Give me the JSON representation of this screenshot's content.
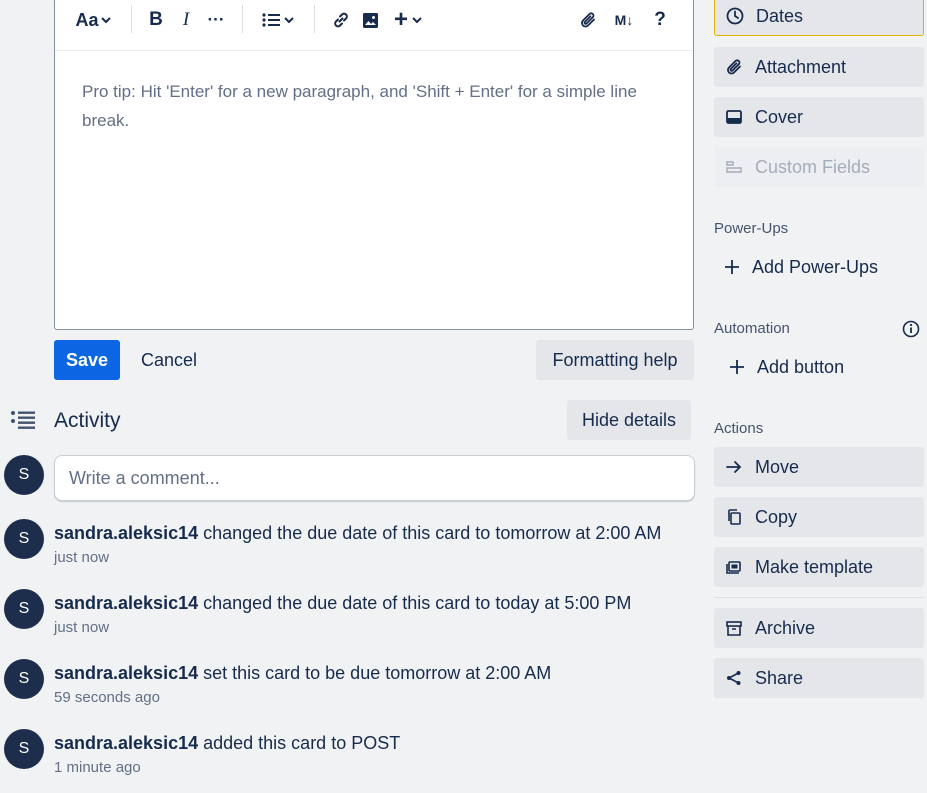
{
  "editor": {
    "toolbar": {
      "text_style": "Aa",
      "bold": "B",
      "italic": "I",
      "more": "···",
      "list": "list",
      "link": "link",
      "image": "image",
      "insert": "+",
      "attach": "attach",
      "markdown": "M↓",
      "help": "?"
    },
    "placeholder": "Pro tip: Hit 'Enter' for a new paragraph, and 'Shift + Enter' for a simple line break."
  },
  "actions": {
    "save": "Save",
    "cancel": "Cancel",
    "formatting_help": "Formatting help"
  },
  "activity": {
    "title": "Activity",
    "hide_details": "Hide details",
    "comment_placeholder": "Write a comment...",
    "avatar_initial": "S",
    "entries": [
      {
        "user": "sandra.aleksic14",
        "text": " changed the due date of this card to tomorrow at 2:00 AM",
        "time": "just now"
      },
      {
        "user": "sandra.aleksic14",
        "text": " changed the due date of this card to today at 5:00 PM",
        "time": "just now"
      },
      {
        "user": "sandra.aleksic14",
        "text": " set this card to be due tomorrow at 2:00 AM",
        "time": "59 seconds ago"
      },
      {
        "user": "sandra.aleksic14",
        "text": " added this card to POST",
        "time": "1 minute ago"
      }
    ]
  },
  "sidebar": {
    "dates": "Dates",
    "attachment": "Attachment",
    "cover": "Cover",
    "custom_fields": "Custom Fields",
    "powerups_heading": "Power-Ups",
    "add_powerups": "Add Power-Ups",
    "automation_heading": "Automation",
    "add_button": "Add button",
    "actions_heading": "Actions",
    "move": "Move",
    "copy": "Copy",
    "make_template": "Make template",
    "archive": "Archive",
    "share": "Share"
  },
  "colors": {
    "primary": "#0c66e4",
    "dates_border": "#e2b203",
    "avatar": "#1d2e4c"
  }
}
